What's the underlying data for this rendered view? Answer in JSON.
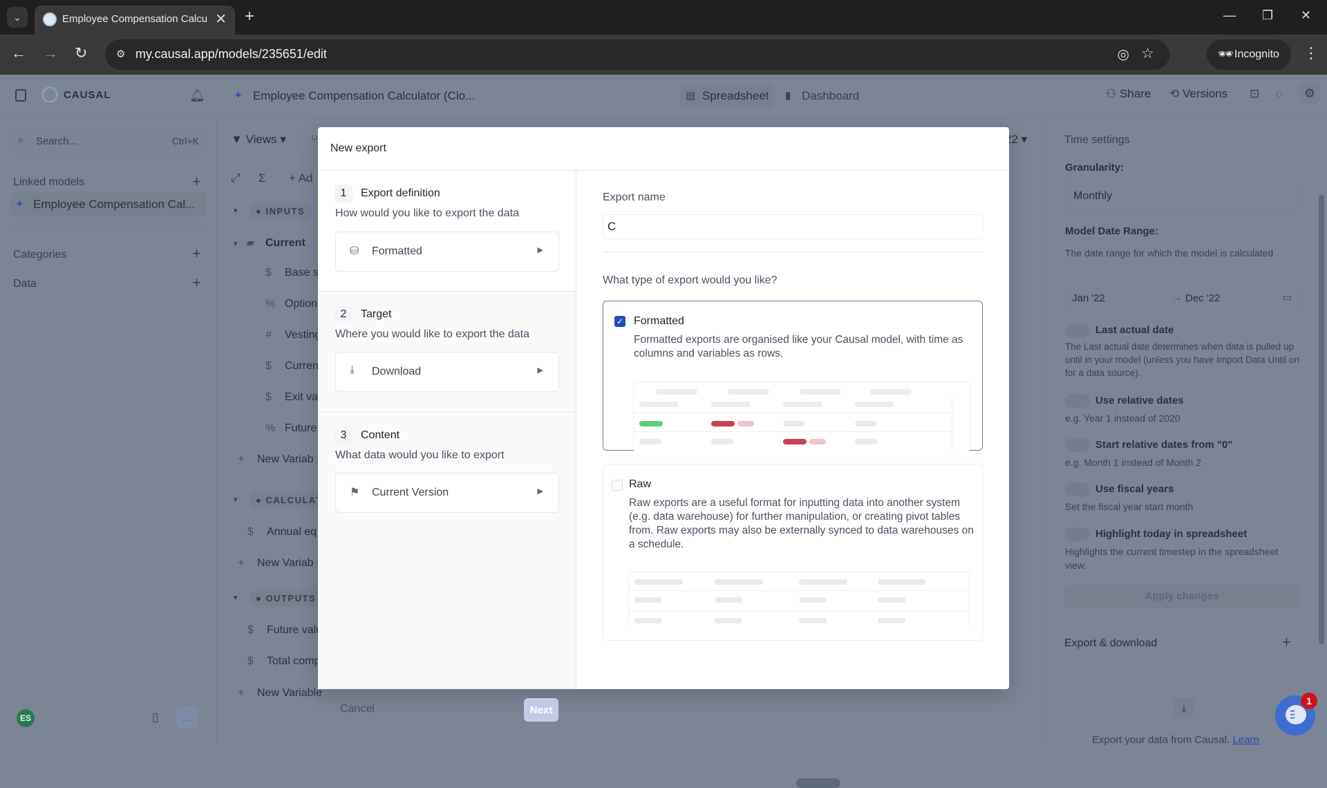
{
  "browser": {
    "tab_title": "Employee Compensation Calcu",
    "url": "my.causal.app/models/235651/edit",
    "incognito_label": "Incognito"
  },
  "app": {
    "brand": "CAUSAL",
    "model_title": "Employee Compensation Calculator (Clo...",
    "view_tabs": [
      {
        "label": "Spreadsheet",
        "active": true
      },
      {
        "label": "Dashboard",
        "active": false
      }
    ],
    "header_actions": {
      "share": "Share",
      "versions": "Versions"
    },
    "sidebar": {
      "search_placeholder": "Search...",
      "search_shortcut": "Ctrl+K",
      "linked_models_label": "Linked models",
      "linked_models": [
        "Employee Compensation Cal..."
      ],
      "categories_label": "Categories",
      "data_label": "Data",
      "avatar_initials": "ES"
    },
    "toolbar": {
      "views": "Views",
      "add": "Ad",
      "date_suffix": "22"
    },
    "tree": {
      "inputs_label": "INPUTS",
      "group_current": "Current",
      "input_rows": [
        {
          "icon": "$",
          "label": "Base s"
        },
        {
          "icon": "%",
          "label": "Option"
        },
        {
          "icon": "#",
          "label": "Vesting"
        },
        {
          "icon": "$",
          "label": "Curren"
        },
        {
          "icon": "$",
          "label": "Exit va"
        },
        {
          "icon": "%",
          "label": "Future"
        }
      ],
      "new_variable": "New Variab",
      "calculations_label": "CALCULAT",
      "calc_rows": [
        {
          "icon": "$",
          "label": "Annual eq"
        }
      ],
      "outputs_label": "OUTPUTS",
      "output_rows": [
        {
          "icon": "$",
          "label": "Future valu"
        },
        {
          "icon": "$",
          "label": "Total comp"
        }
      ],
      "new_variable_full": "New Variable"
    },
    "time_settings": {
      "title": "Time settings",
      "granularity_label": "Granularity:",
      "granularity_value": "Monthly",
      "date_range_label": "Model Date Range:",
      "date_range_desc": "The date range for which the model is calculated",
      "date_from": "Jan '22",
      "date_to": "Dec '22",
      "toggles": [
        {
          "label": "Last actual date",
          "desc": "The Last actual date determines when data is pulled up until in your model (unless you have Import Data Until on for a data source).",
          "on": false
        },
        {
          "label": "Use relative dates",
          "desc": "e.g. Year 1 instead of 2020",
          "on": false
        },
        {
          "label": "Start relative dates from \"0\"",
          "desc": "e.g. Month 1 instead of Month 2",
          "on": false
        },
        {
          "label": "Use fiscal years",
          "desc": "Set the fiscal year start month",
          "on": false
        },
        {
          "label": "Highlight today in spreadsheet",
          "desc": "Highlights the current timestep in the spreadsheet view.",
          "on": false
        }
      ],
      "apply_label": "Apply changes",
      "export_title": "Export & download",
      "export_desc": "Export your data from Causal.",
      "export_link": "Learn"
    },
    "chat_badge": "1"
  },
  "dialog": {
    "title": "New export",
    "steps": [
      {
        "num": "1",
        "title": "Export definition",
        "subtitle": "How would you like to export the data",
        "value": "Formatted",
        "icon": "database-icon"
      },
      {
        "num": "2",
        "title": "Target",
        "subtitle": "Where you would like to export the data",
        "value": "Download",
        "icon": "download-tray-icon"
      },
      {
        "num": "3",
        "title": "Content",
        "subtitle": "What data would you like to export",
        "value": "Current Version",
        "icon": "flag-icon"
      }
    ],
    "cancel_label": "Cancel",
    "next_label": "Next",
    "export_name_label": "Export name",
    "export_name_value": "C",
    "type_question": "What type of export would you like?",
    "options": [
      {
        "title": "Formatted",
        "checked": true,
        "desc": "Formatted exports are organised like your Causal model, with time as columns and variables as rows."
      },
      {
        "title": "Raw",
        "checked": false,
        "desc": "Raw exports are a useful format for inputting data into another system (e.g. data warehouse) for further manipulation, or creating pivot tables from. Raw exports may also be externally synced to data warehouses on a schedule."
      }
    ],
    "colors": {
      "accent": "#1e4fb8",
      "positive": "#5fcf75",
      "negative": "#c94154",
      "negative_light": "#f0c3cb"
    }
  }
}
